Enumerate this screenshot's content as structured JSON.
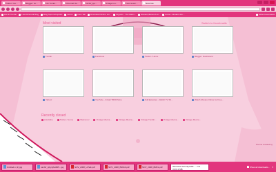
{
  "tabs": [
    {
      "label": "Twitter / Ho..."
    },
    {
      "label": "Blogger: Gi..."
    },
    {
      "label": "Life Tumbl..."
    },
    {
      "label": "Khoomah St..."
    },
    {
      "label": "tumblr_lqo..."
    },
    {
      "label": "vintage lou..."
    },
    {
      "label": "Feed searc..."
    },
    {
      "label": "New Tab",
      "active": true
    }
  ],
  "bookmarks": [
    {
      "label": "Life Ib Tumblr"
    },
    {
      "label": "Lisa Ricenetti Blog"
    },
    {
      "label": "Blog Spoonshophics"
    },
    {
      "label": "Home"
    },
    {
      "label": "New Tab"
    },
    {
      "label": "Download Online Hu..."
    },
    {
      "label": "Organic - The Marin..."
    },
    {
      "label": "Rubied, Bizarrch Ar..."
    },
    {
      "label": "Kova + Modern Pin..."
    }
  ],
  "bookmarks_other": "Other bookmarks",
  "headers": {
    "most_visited": "Most visited",
    "right": "Switch to thumbnails"
  },
  "thumbnails": [
    {
      "label": "Tumblr"
    },
    {
      "label": "Facebook"
    },
    {
      "label": "Twitter / Home"
    },
    {
      "label": "Blogger: Dashboard"
    },
    {
      "label": "Yahoo!"
    },
    {
      "label": "YouTube - Imbali TRFR Mmy"
    },
    {
      "label": "Full Episodes - Watch TV Sh..."
    },
    {
      "label": "Watch Movies Online for Free..."
    }
  ],
  "recently_closed": {
    "title": "Recently closed",
    "items": [
      {
        "label": "zokoMine"
      },
      {
        "label": "Twitter / Home"
      },
      {
        "label": "Welcome!"
      },
      {
        "label": "Vintage Mecca..."
      },
      {
        "label": "Vintage Mecca..."
      },
      {
        "label": "Vintage Tumblr..."
      },
      {
        "label": "Vintage Mecca..."
      },
      {
        "label": "Vintage Mecca..."
      }
    ]
  },
  "theme_credit": "Theme created by",
  "downloads": [
    {
      "label": "Untitled-1 (2).jpg",
      "kind": "img"
    },
    {
      "label": "tumblr_lqhyzjAH605...jpg",
      "kind": "img"
    },
    {
      "label": "NOV_2008_LOVE.pdf",
      "kind": "pdf"
    },
    {
      "label": "NOV_2008_BRIAS.pdf",
      "kind": "pdf"
    },
    {
      "label": "NOV_2008_BMFL.pdf",
      "kind": "pdf"
    }
  ],
  "download_progress": {
    "label": "Windows Security.EXE ... .msi",
    "sub": "3.0/3.1 MB",
    "fraction": 0.97
  },
  "show_all": "Show all downloads...",
  "colors": {
    "accent": "#e2357d",
    "background": "#f8cfdf"
  }
}
